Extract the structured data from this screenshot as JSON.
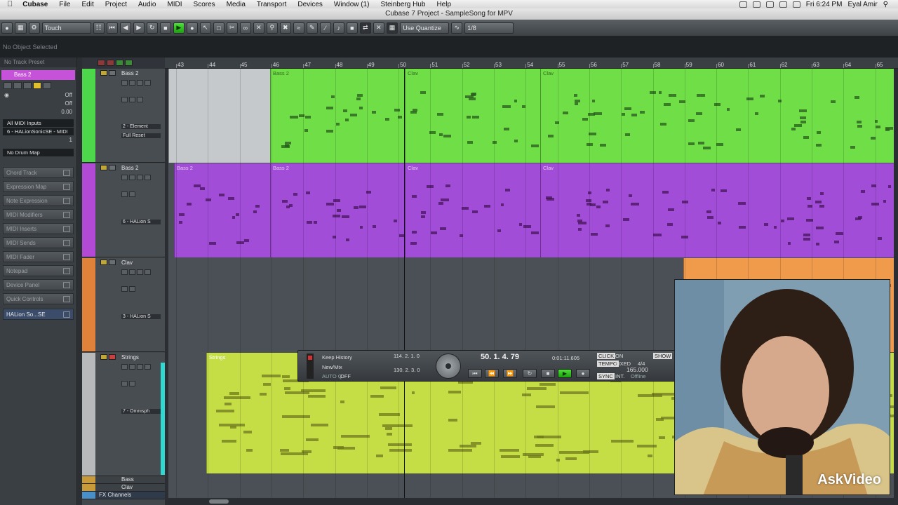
{
  "menubar": {
    "items": [
      "Cubase",
      "File",
      "Edit",
      "Project",
      "Audio",
      "MIDI",
      "Scores",
      "Media",
      "Transport",
      "Devices",
      "Window (1)",
      "Steinberg Hub",
      "Help"
    ],
    "clock": "Fri 6:24 PM",
    "user": "Eyal Amir"
  },
  "window_title": "Cubase 7 Project - SampleSong for MPV",
  "toolbar": {
    "automation_mode": "Touch",
    "quantize_label": "Use Quantize",
    "quantize_value": "1/8"
  },
  "infoline": {
    "text": "No Object Selected"
  },
  "inspector": {
    "preset": "No Track Preset",
    "track_name": "Bass 2",
    "transpose_label": "Off",
    "velocity_label": "Off",
    "value": "0.00",
    "element": "2 - Element",
    "reset": "Full Reset",
    "midi_input": "All MIDI Inputs",
    "midi_output": "6 - HALionSonicSE - MIDI",
    "channel": "1",
    "drum_map": "No Drum Map",
    "sections": [
      {
        "label": "Chord Track"
      },
      {
        "label": "Expression Map"
      },
      {
        "label": "Note Expression"
      },
      {
        "label": "MIDI Modifiers"
      },
      {
        "label": "MIDI Inserts"
      },
      {
        "label": "MIDI Sends"
      },
      {
        "label": "MIDI Fader"
      },
      {
        "label": "Notepad"
      },
      {
        "label": "Device Panel"
      },
      {
        "label": "Quick Controls"
      },
      {
        "label": "HALion So...SE"
      }
    ]
  },
  "tracks": [
    {
      "name": "Bass 2",
      "color": "#4cd84a",
      "output": "2 - Element"
    },
    {
      "name": "Bass 2",
      "color": "#b24ad6",
      "output": "6 - HALion S"
    },
    {
      "name": "Clav",
      "color": "#e0823a",
      "output": "3 - HALion S"
    },
    {
      "name": "Strings",
      "color": "#b7b9bb",
      "output": "7 - Omnisph"
    }
  ],
  "folder_tracks": [
    "Bass",
    "Clav"
  ],
  "fx_channels_label": "FX Channels",
  "ruler": [
    "43",
    "44",
    "45",
    "46",
    "47",
    "48",
    "49",
    "50",
    "51",
    "52",
    "53",
    "54",
    "55",
    "56",
    "57",
    "58",
    "59",
    "60",
    "61",
    "62",
    "63",
    "64",
    "65"
  ],
  "parts": {
    "bass_green": [
      "Bass 2",
      "Clav",
      "Clav"
    ],
    "bass_purple": [
      "Bass 2",
      "Bass 2",
      "Clav",
      "Clav"
    ],
    "strings": "Strings"
  },
  "colors": {
    "green_part": "#6fde47",
    "purple_part": "#a24dd8",
    "yellow_part": "#c6de46",
    "orange_part": "#f09a4c",
    "grey_part": "#c6c9cb",
    "accent_play": "#2ec21e"
  },
  "transport": {
    "history": "Keep History",
    "mix": "New/Mix",
    "auto": "AUTO Q",
    "auto_state": "OFF",
    "left_locator": "114. 2. 1. 0",
    "right_locator": "130. 2. 3. 0",
    "position_bars": "50. 1. 4. 79",
    "position_time": "0:01:11.605",
    "click": "CLICK",
    "click_state": "ON",
    "tempo_label": "TEMPO",
    "tempo_mode": "FIXED",
    "signature": "4/4",
    "tempo": "165.000",
    "sync": "SYNC",
    "sync_mode": "INT.",
    "sync_state": "Offline",
    "show": "SHOW"
  },
  "watermark": "AskVideo"
}
